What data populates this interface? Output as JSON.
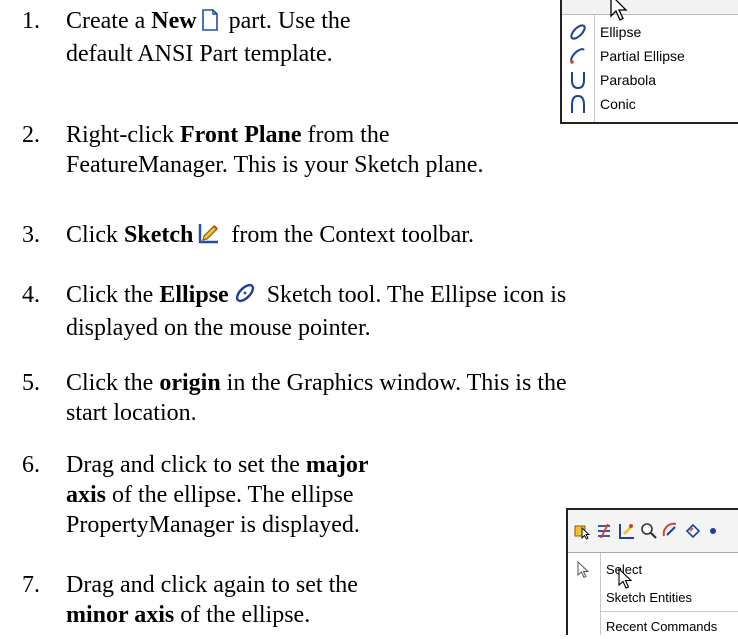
{
  "steps": [
    {
      "num": "1.",
      "parts": [
        "Create a ",
        "New",
        " part. Use the"
      ],
      "line2": "default ANSI Part template."
    },
    {
      "num": "2.",
      "parts": [
        "Right-click ",
        "Front Plane",
        " from the"
      ],
      "line2": "FeatureManager. This is your Sketch plane."
    },
    {
      "num": "3.",
      "parts": [
        "Click ",
        "Sketch",
        " from the Context toolbar."
      ]
    },
    {
      "num": "4.",
      "parts": [
        "Click the ",
        "Ellipse",
        " Sketch tool. The Ellipse icon is"
      ],
      "line2": "displayed on the mouse pointer."
    },
    {
      "num": "5.",
      "parts": [
        "Click the ",
        "origin",
        " in the Graphics window. This is the"
      ],
      "line2": "start location."
    },
    {
      "num": "6.",
      "parts": [
        "Drag and click to set the ",
        "major"
      ],
      "line2b": "axis",
      "line2": " of the ellipse. The ellipse",
      "line3": "PropertyManager is displayed."
    },
    {
      "num": "7.",
      "parts": [
        "Drag and click again to set the"
      ],
      "line2b": "minor axis",
      "line2": " of the ellipse."
    }
  ],
  "sketch_menu": {
    "items": [
      {
        "label": "Ellipse",
        "icon": "ellipse-icon"
      },
      {
        "label": "Partial Ellipse",
        "icon": "partial-ellipse-icon"
      },
      {
        "label": "Parabola",
        "icon": "parabola-icon"
      },
      {
        "label": "Conic",
        "icon": "conic-icon"
      }
    ]
  },
  "shortcut_menu": {
    "items": [
      {
        "label": "Select"
      },
      {
        "label": "Sketch Entities"
      },
      {
        "label": "Recent Commands"
      }
    ]
  }
}
